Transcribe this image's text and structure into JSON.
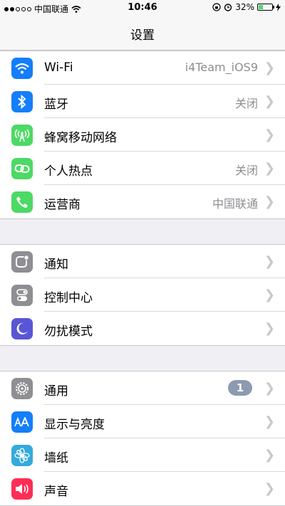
{
  "status_bar": {
    "signal": "●●○○○",
    "carrier": "中国联通",
    "time": "10:46",
    "battery": "32%",
    "battery_level": 0.32
  },
  "nav": {
    "title": "设置"
  },
  "groups": [
    [
      {
        "label": "Wi-Fi",
        "detail": "i4Team_iOS9",
        "icon": "wifi-icon",
        "color": "#147efb"
      },
      {
        "label": "蓝牙",
        "detail": "关闭",
        "icon": "bluetooth-icon",
        "color": "#147efb"
      },
      {
        "label": "蜂窝移动网络",
        "detail": "",
        "icon": "cellular-icon",
        "color": "#4cd964"
      },
      {
        "label": "个人热点",
        "detail": "关闭",
        "icon": "hotspot-icon",
        "color": "#4cd964"
      },
      {
        "label": "运营商",
        "detail": "中国联通",
        "icon": "phone-icon",
        "color": "#4cd964"
      }
    ],
    [
      {
        "label": "通知",
        "icon": "notifications-icon",
        "color": "#8e8e93"
      },
      {
        "label": "控制中心",
        "icon": "control-center-icon",
        "color": "#8e8e93"
      },
      {
        "label": "勿扰模式",
        "icon": "moon-icon",
        "color": "#5856d6"
      }
    ],
    [
      {
        "label": "通用",
        "badge": "1",
        "icon": "gear-icon",
        "color": "#8e8e93"
      },
      {
        "label": "显示与亮度",
        "icon": "display-icon",
        "color": "#147efb"
      },
      {
        "label": "墙纸",
        "icon": "wallpaper-icon",
        "color": "#34aadc"
      },
      {
        "label": "声音",
        "icon": "sound-icon",
        "color": "#ff2d55"
      }
    ]
  ]
}
